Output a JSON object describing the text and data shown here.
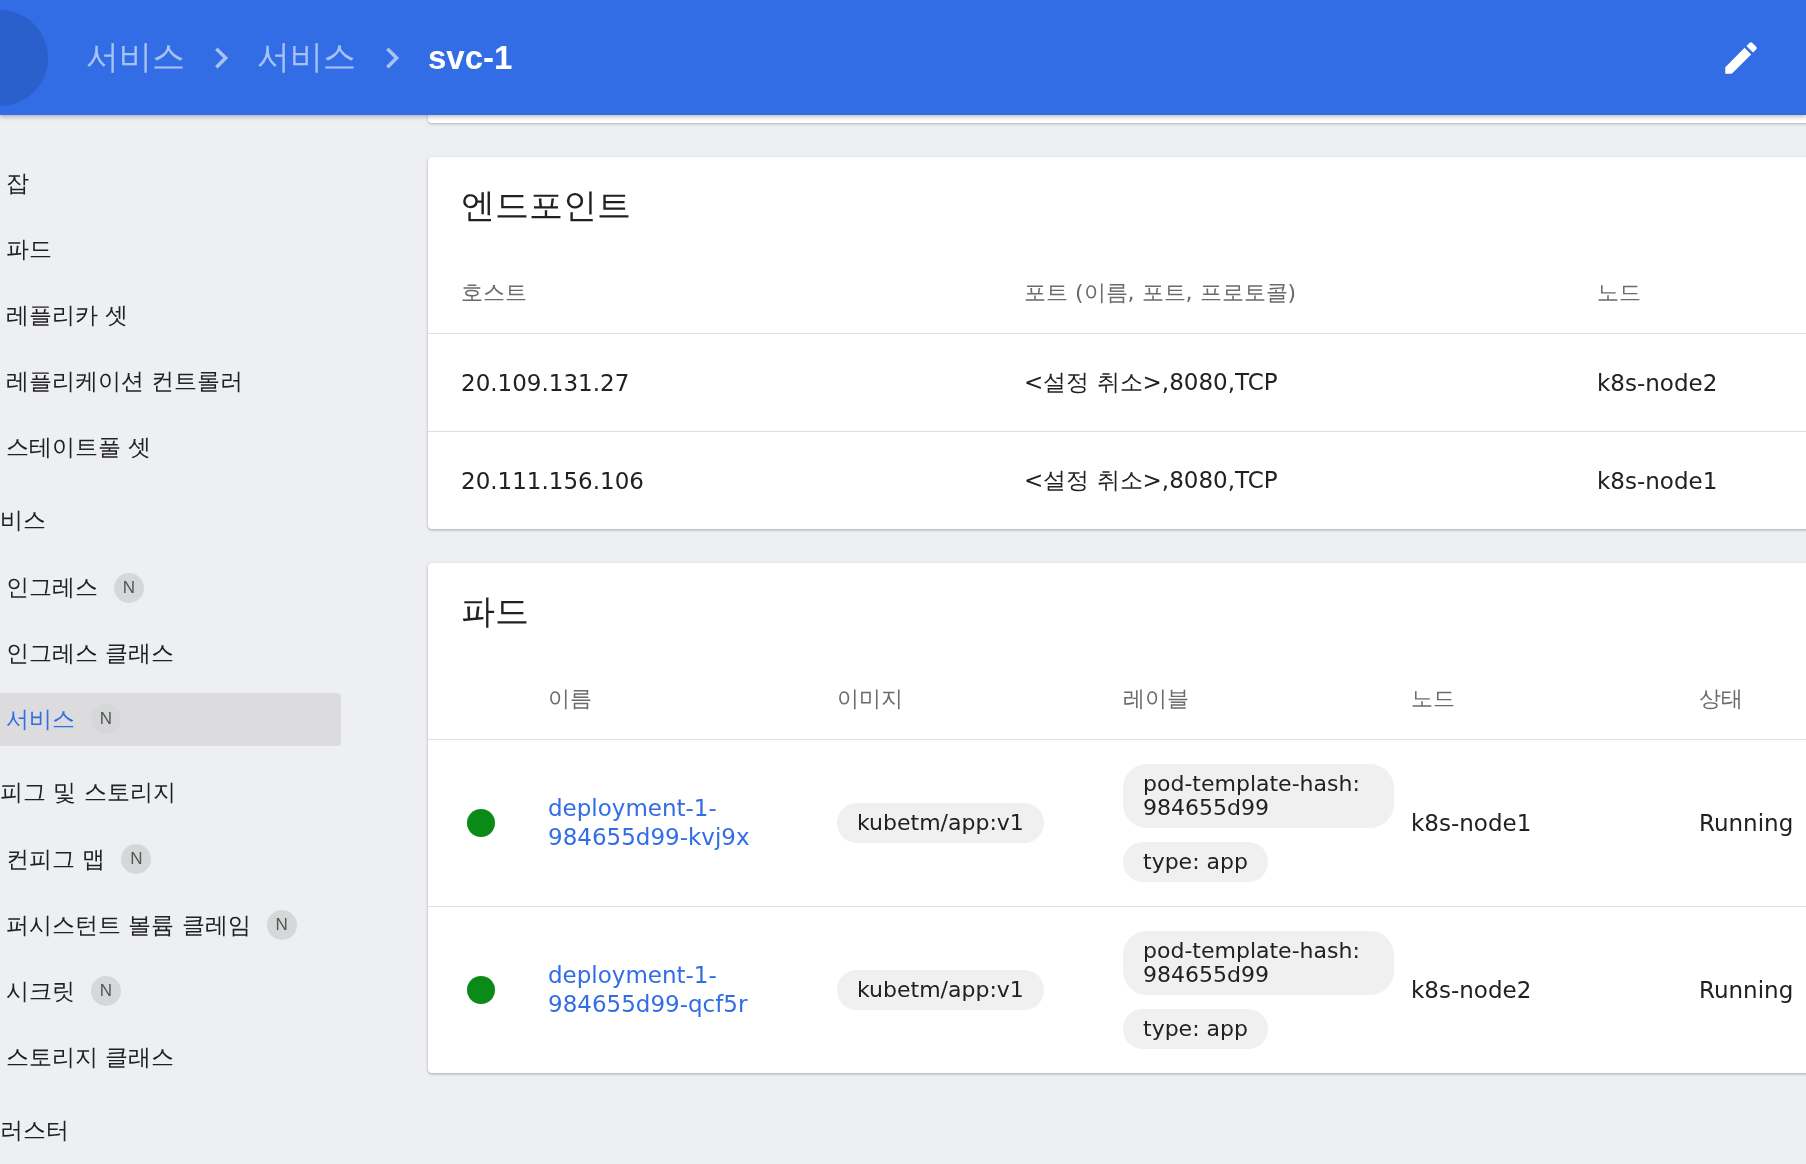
{
  "header": {
    "breadcrumbs": [
      {
        "label": "서비스",
        "current": false
      },
      {
        "label": "서비스",
        "current": false
      },
      {
        "label": "svc-1",
        "current": true
      }
    ]
  },
  "sidebar": {
    "items": [
      {
        "kind": "item",
        "label": "잡",
        "selected": false
      },
      {
        "kind": "item",
        "label": "파드",
        "selected": false
      },
      {
        "kind": "item",
        "label": "레플리카 셋",
        "selected": false
      },
      {
        "kind": "item",
        "label": "레플리케이션 컨트롤러",
        "selected": false
      },
      {
        "kind": "item",
        "label": "스테이트풀 셋",
        "selected": false
      },
      {
        "kind": "section",
        "label": "비스"
      },
      {
        "kind": "item",
        "label": "인그레스",
        "badge": "N",
        "selected": false
      },
      {
        "kind": "item",
        "label": "인그레스 클래스",
        "selected": false
      },
      {
        "kind": "item",
        "label": "서비스",
        "badge": "N",
        "selected": true
      },
      {
        "kind": "section",
        "label": "피그 및 스토리지"
      },
      {
        "kind": "item",
        "label": "컨피그 맵",
        "badge": "N",
        "selected": false
      },
      {
        "kind": "item",
        "label": "퍼시스턴트 볼륨 클레임",
        "badge": "N",
        "selected": false
      },
      {
        "kind": "item",
        "label": "시크릿",
        "badge": "N",
        "selected": false
      },
      {
        "kind": "item",
        "label": "스토리지 클래스",
        "selected": false
      },
      {
        "kind": "section",
        "label": "러스터"
      }
    ]
  },
  "endpoints": {
    "title": "엔드포인트",
    "columns": [
      "호스트",
      "포트 (이름, 포트, 프로토콜)",
      "노드"
    ],
    "rows": [
      [
        "20.109.131.27",
        "<설정 취소>,8080,TCP",
        "k8s-node2"
      ],
      [
        "20.111.156.106",
        "<설정 취소>,8080,TCP",
        "k8s-node1"
      ]
    ]
  },
  "pods": {
    "title": "파드",
    "columns": [
      "이름",
      "이미지",
      "레이블",
      "노드",
      "상태"
    ],
    "rows": [
      {
        "color": "#0a8a16",
        "name": "deployment-1-984655d99-kvj9x",
        "image": "kubetm/app:v1",
        "labels": [
          "pod-template-hash: 984655d99",
          "type: app"
        ],
        "node": "k8s-node1",
        "status": "Running"
      },
      {
        "color": "#0a8a16",
        "name": "deployment-1-984655d99-qcf5r",
        "image": "kubetm/app:v1",
        "labels": [
          "pod-template-hash: 984655d99",
          "type: app"
        ],
        "node": "k8s-node2",
        "status": "Running"
      }
    ]
  }
}
